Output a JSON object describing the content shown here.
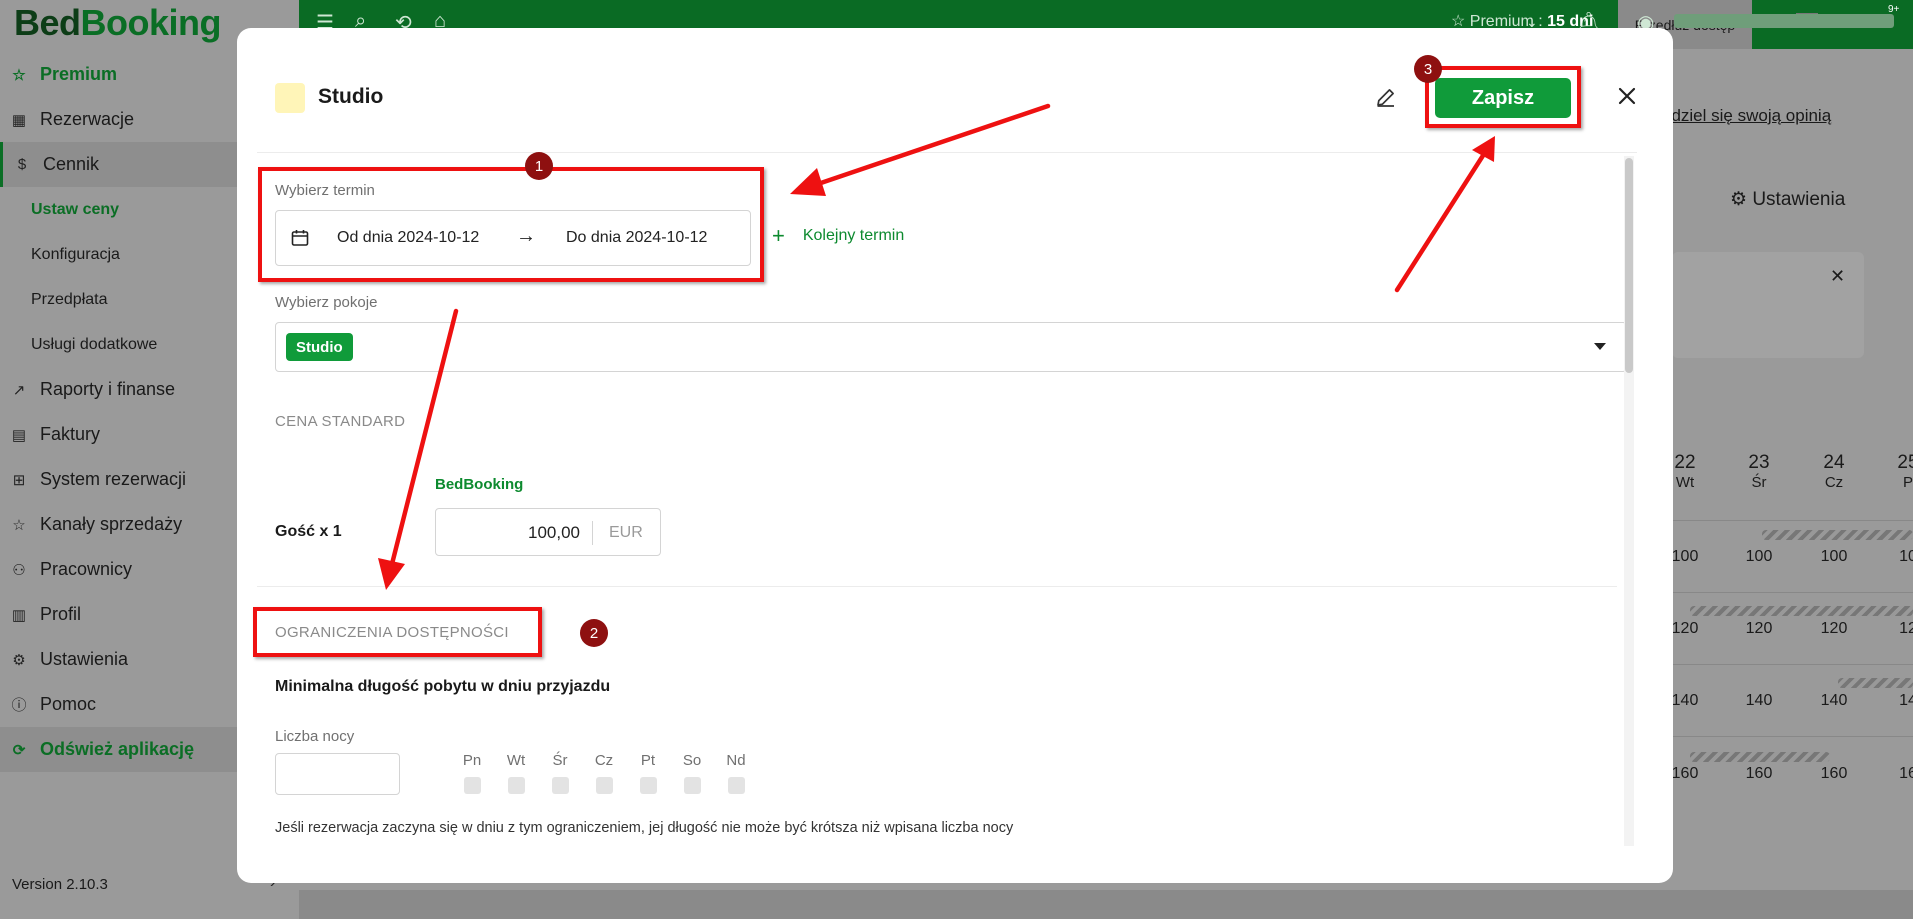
{
  "app": {
    "logo_part1": "Bed",
    "logo_part2": "Booking",
    "version": "Version 2.10.3"
  },
  "sidebar": {
    "items": [
      {
        "label": "Premium"
      },
      {
        "label": "Rezerwacje"
      },
      {
        "label": "Cennik"
      },
      {
        "label": "Ustaw ceny"
      },
      {
        "label": "Konfiguracja"
      },
      {
        "label": "Przedpłata"
      },
      {
        "label": "Usługi dodatkowe"
      },
      {
        "label": "Raporty i finanse"
      },
      {
        "label": "Faktury"
      },
      {
        "label": "System rezerwacji"
      },
      {
        "label": "Kanały sprzedaży"
      },
      {
        "label": "Pracownicy"
      },
      {
        "label": "Profil"
      },
      {
        "label": "Ustawienia"
      },
      {
        "label": "Pomoc"
      },
      {
        "label": "Odśwież aplikację"
      }
    ]
  },
  "topbar": {
    "premium_label": "Premium :",
    "premium_days": "15 dni",
    "extend_label": "Przedłuż dostęp",
    "notif_badge": "9+"
  },
  "background": {
    "opinion_link": "odziel się swoją opinią",
    "settings_link": "Ustawienia",
    "calendar_days": [
      {
        "day": "22",
        "weekday": "Wt"
      },
      {
        "day": "23",
        "weekday": "Śr"
      },
      {
        "day": "24",
        "weekday": "Cz"
      },
      {
        "day": "25",
        "weekday": "P"
      }
    ],
    "calendar_rows": [
      [
        "100",
        "100",
        "100",
        "10"
      ],
      [
        "120",
        "120",
        "120",
        "12"
      ],
      [
        "140",
        "140",
        "140",
        "14"
      ],
      [
        "160",
        "160",
        "160",
        "16"
      ]
    ]
  },
  "modal": {
    "title": "Studio",
    "save_label": "Zapisz",
    "term_label": "Wybierz termin",
    "date_from": "Od dnia 2024-10-12",
    "date_to": "Do dnia 2024-10-12",
    "add_term_label": "Kolejny termin",
    "rooms_label": "Wybierz pokoje",
    "room_tag": "Studio",
    "price_section": "CENA STANDARD",
    "channel": "BedBooking",
    "guest_label": "Gość x 1",
    "price_value": "100,00",
    "currency": "EUR",
    "availability_section": "OGRANICZENIA DOSTĘPNOŚCI",
    "min_stay_title": "Minimalna długość pobytu w dniu przyjazdu",
    "nights_label": "Liczba nocy",
    "weekdays": [
      "Pn",
      "Wt",
      "Śr",
      "Cz",
      "Pt",
      "So",
      "Nd"
    ],
    "help_text": "Jeśli rezerwacja zaczyna się w dniu z tym ograniczeniem, jej długość nie może być krótsza niż wpisana liczba nocy"
  },
  "annotations": {
    "markers": [
      "1",
      "2",
      "3"
    ]
  },
  "colors": {
    "brand_green": "#0a6b24",
    "button_green": "#109b3a",
    "annotation_red": "#ee1111",
    "marker_dark_red": "#8e1010"
  }
}
